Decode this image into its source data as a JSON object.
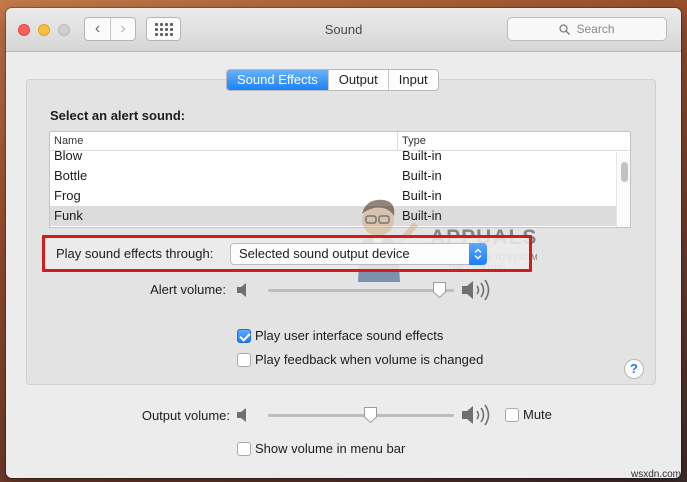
{
  "window": {
    "title": "Sound"
  },
  "search": {
    "placeholder": "Search"
  },
  "tabs": [
    {
      "label": "Sound Effects",
      "selected": true
    },
    {
      "label": "Output",
      "selected": false
    },
    {
      "label": "Input",
      "selected": false
    }
  ],
  "alerts": {
    "heading": "Select an alert sound:",
    "columns": [
      "Name",
      "Type"
    ],
    "rows": [
      {
        "name": "Blow",
        "type": "Built-in"
      },
      {
        "name": "Bottle",
        "type": "Built-in"
      },
      {
        "name": "Frog",
        "type": "Built-in"
      },
      {
        "name": "Funk",
        "type": "Built-in",
        "selected": true
      }
    ]
  },
  "play_through": {
    "label": "Play sound effects through:",
    "selected_value": "Selected sound output device"
  },
  "alert_volume": {
    "label": "Alert volume:",
    "level": 0.92
  },
  "checkboxes": {
    "ui_sounds": {
      "label": "Play user interface sound effects",
      "checked": true
    },
    "feedback": {
      "label": "Play feedback when volume is changed",
      "checked": false
    }
  },
  "output_volume": {
    "label": "Output volume:",
    "level": 0.55
  },
  "mute": {
    "label": "Mute",
    "checked": false
  },
  "show_volume": {
    "label": "Show volume in menu bar",
    "checked": false
  },
  "help": {
    "label": "?"
  },
  "watermark": {
    "brand": "APPUALS",
    "tagline_1": "TECH HOW-TO'S FROM",
    "tagline_2": "THE EXPERTS!"
  },
  "credit": "wsxdn.com",
  "colors": {
    "accent": "#1a82fb",
    "highlight_box": "#d51a1a"
  }
}
